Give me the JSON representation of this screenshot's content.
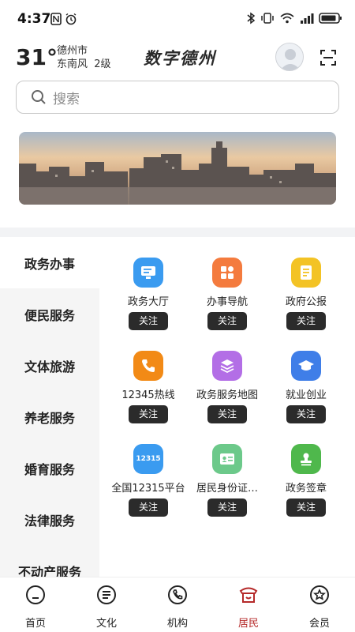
{
  "status": {
    "time": "4:37"
  },
  "header": {
    "temperature": "31°",
    "city": "德州市",
    "wind": "东南风  2级",
    "title": "数字德州"
  },
  "search": {
    "placeholder": "搜索"
  },
  "sidebar": {
    "items": [
      {
        "label": "政务办事",
        "active": true
      },
      {
        "label": "便民服务",
        "active": false
      },
      {
        "label": "文体旅游",
        "active": false
      },
      {
        "label": "养老服务",
        "active": false
      },
      {
        "label": "婚育服务",
        "active": false
      },
      {
        "label": "法律服务",
        "active": false
      },
      {
        "label": "不动产服务",
        "active": false
      }
    ]
  },
  "services": [
    {
      "label": "政务大厅",
      "follow": "关注",
      "icon": "monitor-icon",
      "color": "#3a9bf0"
    },
    {
      "label": "办事导航",
      "follow": "关注",
      "icon": "grid-apps-icon",
      "color": "#f47b3e"
    },
    {
      "label": "政府公报",
      "follow": "关注",
      "icon": "document-icon",
      "color": "#f3c325"
    },
    {
      "label": "12345热线",
      "follow": "关注",
      "icon": "phone-icon",
      "color": "#f28a16"
    },
    {
      "label": "政务服务地图",
      "follow": "关注",
      "icon": "layers-icon",
      "color": "#b36ee6"
    },
    {
      "label": "就业创业",
      "follow": "关注",
      "icon": "graduation-cap-icon",
      "color": "#3f7ee8"
    },
    {
      "label": "全国12315平台",
      "follow": "关注",
      "icon": "12315-icon",
      "icon_text": "12315",
      "color": "#3a9bf0"
    },
    {
      "label": "居民身份证…",
      "follow": "关注",
      "icon": "id-card-icon",
      "color": "#6cc98a"
    },
    {
      "label": "政务签章",
      "follow": "关注",
      "icon": "stamp-icon",
      "color": "#4fb84c"
    }
  ],
  "tabs": [
    {
      "label": "首页",
      "icon": "home-icon",
      "active": false
    },
    {
      "label": "文化",
      "icon": "culture-icon",
      "active": false
    },
    {
      "label": "机构",
      "icon": "phone-org-icon",
      "active": false
    },
    {
      "label": "居民",
      "icon": "resident-icon",
      "active": true
    },
    {
      "label": "会员",
      "icon": "member-icon",
      "active": false
    }
  ],
  "colors": {
    "active_tab": "#b52a2a",
    "follow_bg": "#2b2b2b",
    "sidebar_bg": "#f5f5f5"
  }
}
